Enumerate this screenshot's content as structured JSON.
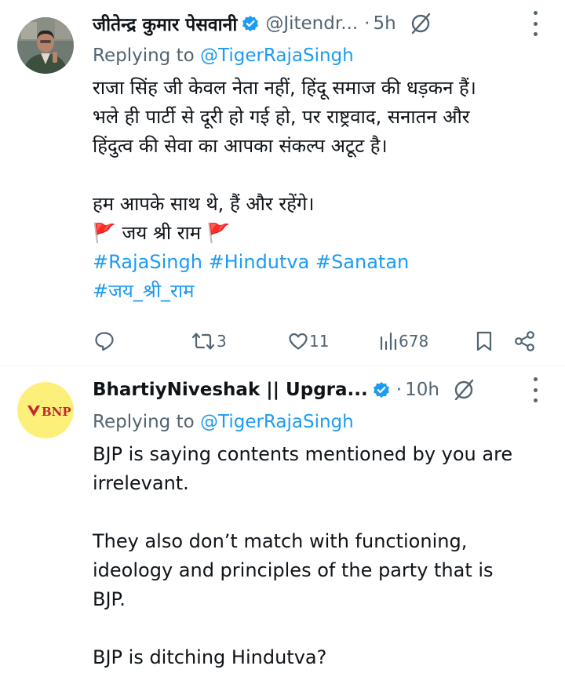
{
  "tweets": [
    {
      "author_name": "जीतेन्द्र कुमार पेसवानी",
      "handle": "@Jitendr...",
      "separator": "·",
      "time": "5h",
      "replying_prefix": "Replying to ",
      "replying_to": "@TigerRajaSingh",
      "body": "राजा सिंह जी केवल नेता नहीं, हिंदू समाज की धड़कन हैं।\nभले ही पार्टी से दूरी हो गई हो, पर राष्ट्रवाद, सनातन और\nहिंदुत्व की सेवा का आपका संकल्प अटूट है।\n\nहम आपके साथ थे, हैं और रहेंगे।",
      "flag_line": "🚩 जय श्री राम 🚩",
      "hashtags_line1": "#RajaSingh #Hindutva #Sanatan",
      "hashtags_line2": "#जय_श्री_राम",
      "retweets": "3",
      "likes": "11",
      "views": "678"
    },
    {
      "author_name": "BhartiyNiveshak || Upgra...",
      "avatar_text": "BNP",
      "separator": "·",
      "time": "10h",
      "replying_prefix": "Replying to ",
      "replying_to": "@TigerRajaSingh",
      "body": "BJP is saying contents mentioned by you are\nirrelevant.\n\nThey also don’t match with functioning,\nideology and principles of the party that is\nBJP.\n\nBJP is ditching Hindutva?"
    }
  ],
  "colors": {
    "link": "#1d9bf0",
    "muted": "#536471",
    "verified": "#1d9bf0",
    "bnp_avatar_bg": "#fdf07a",
    "bnp_red": "#c1272d"
  },
  "icons": [
    "verified-badge-icon",
    "grok-icon",
    "more-options-icon",
    "reply-icon",
    "retweet-icon",
    "like-icon",
    "views-icon",
    "bookmark-icon",
    "share-icon"
  ]
}
